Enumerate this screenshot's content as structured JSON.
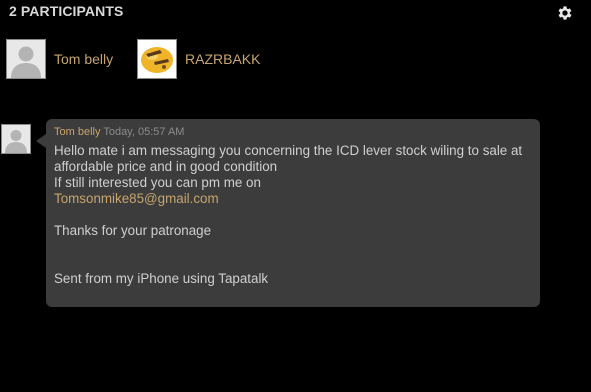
{
  "header": {
    "title": "2 PARTICIPANTS",
    "settings_icon": "gear-icon"
  },
  "participants": [
    {
      "name": "Tom belly",
      "avatar": "default-user-avatar"
    },
    {
      "name": "RAZRBAKK",
      "avatar": "custom-avatar-yellow"
    }
  ],
  "message": {
    "author": "Tom belly",
    "time": "Today, 05:57 AM",
    "lines": [
      "Hello mate i am messaging you concerning the ICD lever stock wiling to sale at",
      "affordable price and in good condition",
      "If still interested you can pm me on"
    ],
    "email": "Tomsonmike85@gmail.com",
    "thanks": "Thanks for your patronage",
    "signature": "Sent from my iPhone using Tapatalk"
  },
  "colors": {
    "background": "#000000",
    "accent": "#c7a46c",
    "bubble": "#3c3c3c",
    "text": "#cfcfcf"
  }
}
